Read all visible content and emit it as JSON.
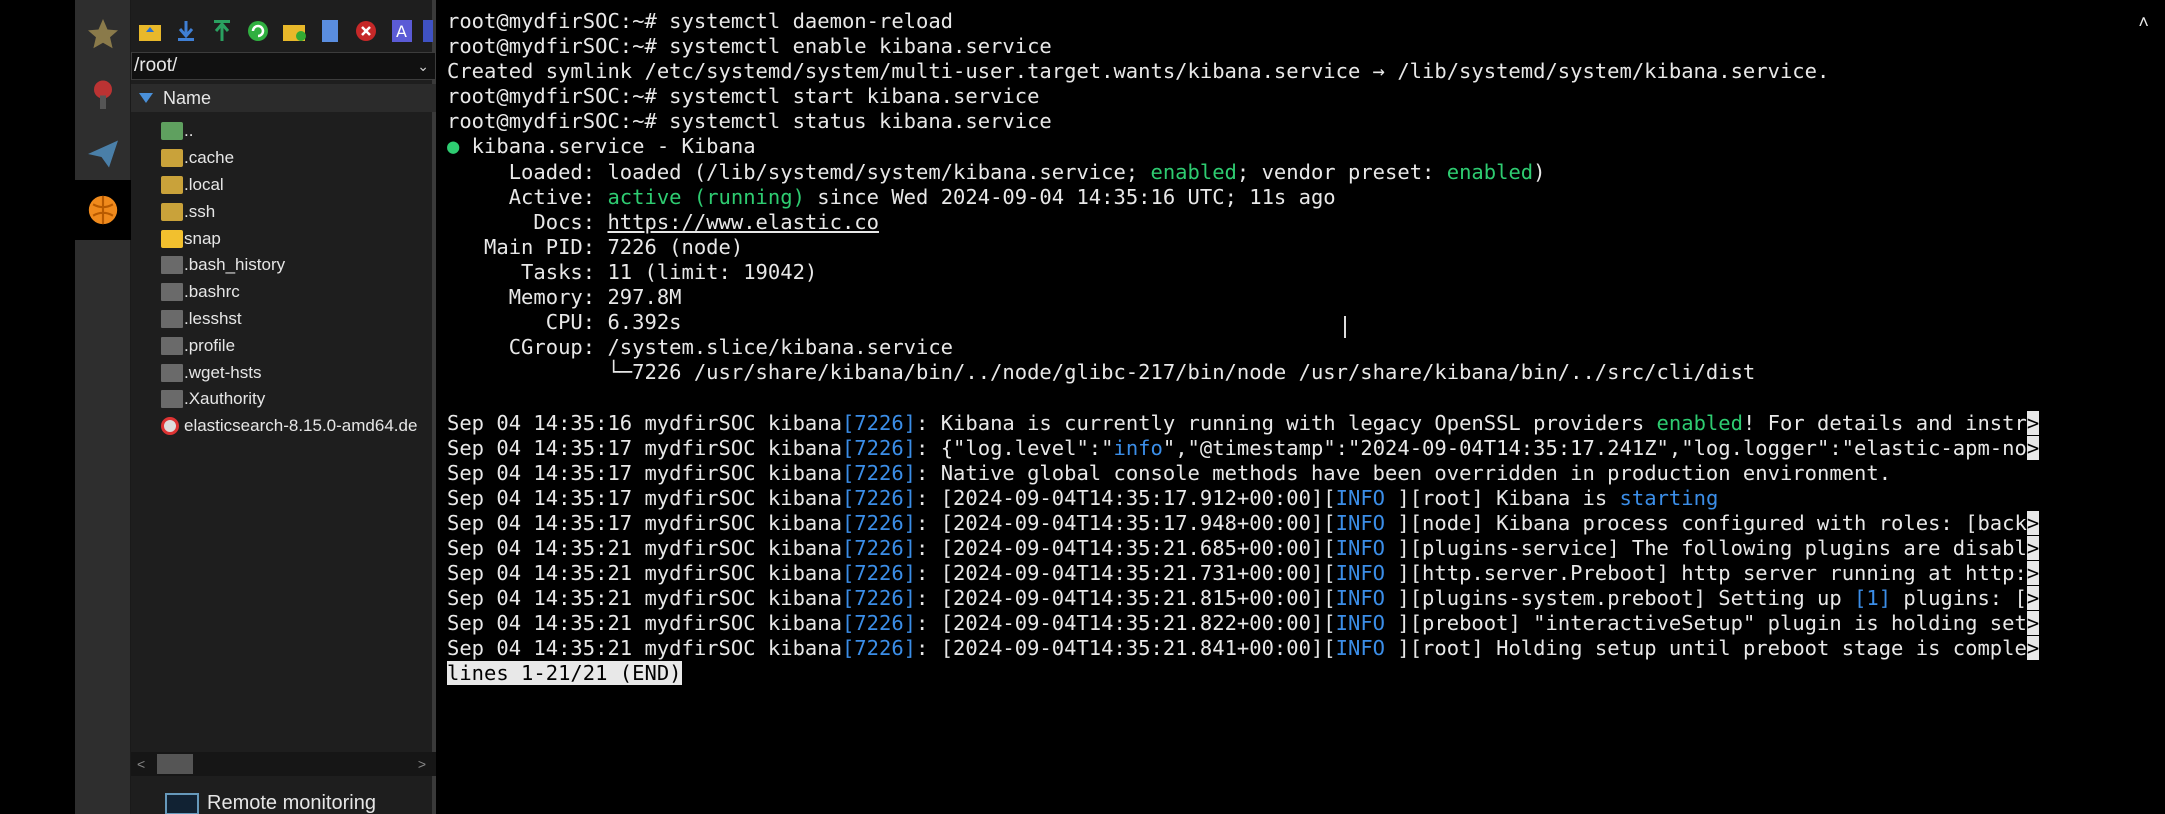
{
  "file_panel": {
    "path": "/root/",
    "column_header": "Name",
    "files": [
      {
        "name": "..",
        "icon": "parent-dir-icon"
      },
      {
        "name": ".cache",
        "icon": "folder-icon"
      },
      {
        "name": ".local",
        "icon": "folder-icon"
      },
      {
        "name": ".ssh",
        "icon": "folder-icon"
      },
      {
        "name": "snap",
        "icon": "folder-icon"
      },
      {
        "name": ".bash_history",
        "icon": "file-icon"
      },
      {
        "name": ".bashrc",
        "icon": "file-icon"
      },
      {
        "name": ".lesshst",
        "icon": "file-icon"
      },
      {
        "name": ".profile",
        "icon": "file-icon"
      },
      {
        "name": ".wget-hsts",
        "icon": "file-icon"
      },
      {
        "name": ".Xauthority",
        "icon": "file-icon"
      },
      {
        "name": "elasticsearch-8.15.0-amd64.de",
        "icon": "package-icon"
      }
    ],
    "remote_monitoring": "Remote monitoring"
  },
  "terminal": {
    "lines": [
      [
        {
          "t": "root@mydfirSOC:~# systemctl daemon-reload"
        }
      ],
      [
        {
          "t": "root@mydfirSOC:~# systemctl enable kibana.service"
        }
      ],
      [
        {
          "t": "Created symlink /etc/systemd/system/multi-user.target.wants/kibana.service → /lib/systemd/system/kibana.service."
        }
      ],
      [
        {
          "t": "root@mydfirSOC:~# systemctl start kibana.service"
        }
      ],
      [
        {
          "t": "root@mydfirSOC:~# systemctl status kibana.service"
        }
      ],
      [
        {
          "t": "●",
          "c": "g"
        },
        {
          "t": " kibana.service - Kibana"
        }
      ],
      [
        {
          "t": "     Loaded: loaded (/lib/systemd/system/kibana.service; "
        },
        {
          "t": "enabled",
          "c": "g"
        },
        {
          "t": "; vendor preset: "
        },
        {
          "t": "enabled",
          "c": "g"
        },
        {
          "t": ")"
        }
      ],
      [
        {
          "t": "     Active: "
        },
        {
          "t": "active (running)",
          "c": "g"
        },
        {
          "t": " since Wed 2024-09-04 14:35:16 UTC; 11s ago"
        }
      ],
      [
        {
          "t": "       Docs: "
        },
        {
          "t": "https://www.elastic.co",
          "c": "u"
        }
      ],
      [
        {
          "t": "   Main PID: 7226 (node)"
        }
      ],
      [
        {
          "t": "      Tasks: 11 (limit: 19042)"
        }
      ],
      [
        {
          "t": "     Memory: 297.8M"
        }
      ],
      [
        {
          "t": "        CPU: 6.392s"
        }
      ],
      [
        {
          "t": "     CGroup: /system.slice/kibana.service"
        }
      ],
      [
        {
          "t": "             └─7226 /usr/share/kibana/bin/../node/glibc-217/bin/node /usr/share/kibana/bin/../src/cli/dist"
        }
      ],
      [
        {
          "t": ""
        }
      ],
      [
        {
          "t": "Sep 04 14:35:16 mydfirSOC kibana"
        },
        {
          "t": "[7226]",
          "c": "b"
        },
        {
          "t": ": Kibana is currently running with legacy OpenSSL providers "
        },
        {
          "t": "enabled",
          "c": "g"
        },
        {
          "t": "! For details and instr"
        },
        {
          "t": ">",
          "c": "hl"
        }
      ],
      [
        {
          "t": "Sep 04 14:35:17 mydfirSOC kibana"
        },
        {
          "t": "[7226]",
          "c": "b"
        },
        {
          "t": ": {\"log.level\":\""
        },
        {
          "t": "info",
          "c": "b"
        },
        {
          "t": "\",\"@timestamp\":\"2024-09-04T14:35:17.241Z\",\"log.logger\":\"elastic-apm-no"
        },
        {
          "t": ">",
          "c": "hl"
        }
      ],
      [
        {
          "t": "Sep 04 14:35:17 mydfirSOC kibana"
        },
        {
          "t": "[7226]",
          "c": "b"
        },
        {
          "t": ": Native global console methods have been overridden in production environment."
        }
      ],
      [
        {
          "t": "Sep 04 14:35:17 mydfirSOC kibana"
        },
        {
          "t": "[7226]",
          "c": "b"
        },
        {
          "t": ": [2024-09-04T14:35:17.912+00:00]["
        },
        {
          "t": "INFO ",
          "c": "b"
        },
        {
          "t": "][root] Kibana is "
        },
        {
          "t": "starting",
          "c": "b"
        }
      ],
      [
        {
          "t": "Sep 04 14:35:17 mydfirSOC kibana"
        },
        {
          "t": "[7226]",
          "c": "b"
        },
        {
          "t": ": [2024-09-04T14:35:17.948+00:00]["
        },
        {
          "t": "INFO ",
          "c": "b"
        },
        {
          "t": "][node] Kibana process configured with roles: [back"
        },
        {
          "t": ">",
          "c": "hl"
        }
      ],
      [
        {
          "t": "Sep 04 14:35:21 mydfirSOC kibana"
        },
        {
          "t": "[7226]",
          "c": "b"
        },
        {
          "t": ": [2024-09-04T14:35:21.685+00:00]["
        },
        {
          "t": "INFO ",
          "c": "b"
        },
        {
          "t": "][plugins-service] The following plugins are disabl"
        },
        {
          "t": ">",
          "c": "hl"
        }
      ],
      [
        {
          "t": "Sep 04 14:35:21 mydfirSOC kibana"
        },
        {
          "t": "[7226]",
          "c": "b"
        },
        {
          "t": ": [2024-09-04T14:35:21.731+00:00]["
        },
        {
          "t": "INFO ",
          "c": "b"
        },
        {
          "t": "][http.server.Preboot] http server running at http:"
        },
        {
          "t": ">",
          "c": "hl"
        }
      ],
      [
        {
          "t": "Sep 04 14:35:21 mydfirSOC kibana"
        },
        {
          "t": "[7226]",
          "c": "b"
        },
        {
          "t": ": [2024-09-04T14:35:21.815+00:00]["
        },
        {
          "t": "INFO ",
          "c": "b"
        },
        {
          "t": "][plugins-system.preboot] Setting up "
        },
        {
          "t": "[1]",
          "c": "b"
        },
        {
          "t": " plugins: ["
        },
        {
          "t": ">",
          "c": "hl"
        }
      ],
      [
        {
          "t": "Sep 04 14:35:21 mydfirSOC kibana"
        },
        {
          "t": "[7226]",
          "c": "b"
        },
        {
          "t": ": [2024-09-04T14:35:21.822+00:00]["
        },
        {
          "t": "INFO ",
          "c": "b"
        },
        {
          "t": "][preboot] \"interactiveSetup\" plugin is holding set"
        },
        {
          "t": ">",
          "c": "hl"
        }
      ],
      [
        {
          "t": "Sep 04 14:35:21 mydfirSOC kibana"
        },
        {
          "t": "[7226]",
          "c": "b"
        },
        {
          "t": ": [2024-09-04T14:35:21.841+00:00]["
        },
        {
          "t": "INFO ",
          "c": "b"
        },
        {
          "t": "][root] Holding setup until preboot stage is comple"
        },
        {
          "t": ">",
          "c": "hl"
        }
      ],
      [
        {
          "t": "lines 1-21/21 (END)",
          "c": "hl"
        }
      ]
    ]
  },
  "colors": {
    "green": "#2ecc71",
    "blue": "#3b8ee8",
    "terminal_bg": "#000000",
    "panel_bg": "#1e1e1e"
  }
}
